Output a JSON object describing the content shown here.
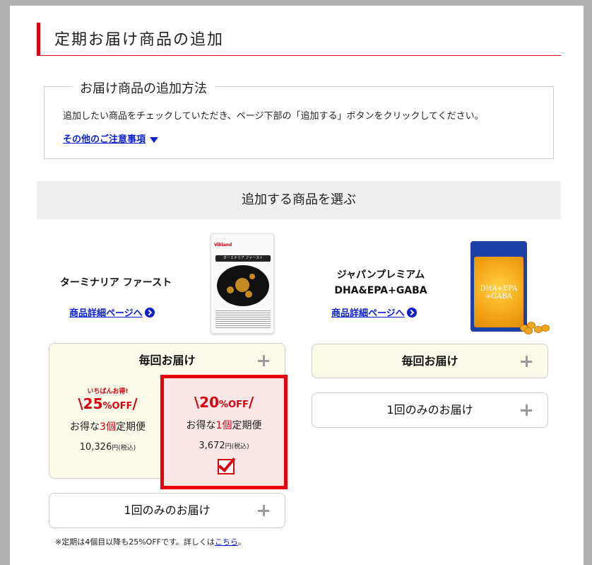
{
  "page_title": "定期お届け商品の追加",
  "method": {
    "heading": "お届け商品の追加方法",
    "text": "追加したい商品をチェックしていただき、ページ下部の「追加する」ボタンをクリックしてください。",
    "notes_link": "その他のご注意事項"
  },
  "select_heading": "追加する商品を選ぶ",
  "products": [
    {
      "name": "ターミナリア ファースト",
      "detail_link": "商品詳細ページへ",
      "image_brand": "Vikland",
      "image_label": "ターミナリア ファースト",
      "every_time": {
        "label": "毎回お届け",
        "options": [
          {
            "badge": "いちばんお得!",
            "off_pre": "\\",
            "off_num": "25",
            "off_unit": "%OFF",
            "off_post": "/",
            "desc_pre": "お得な",
            "desc_num": "3個",
            "desc_post": "定期便",
            "price": "10,326",
            "price_unit": "円(税込)",
            "selected": false
          },
          {
            "badge": "",
            "off_pre": "\\",
            "off_num": "20",
            "off_unit": "%OFF",
            "off_post": "/",
            "desc_pre": "お得な",
            "desc_num": "1個",
            "desc_post": "定期便",
            "price": "3,672",
            "price_unit": "円(税込)",
            "selected": true
          }
        ]
      },
      "once": {
        "label": "1回のみのお届け"
      }
    },
    {
      "name_line1": "ジャパンプレミアム",
      "name_line2": "DHA&EPA+GABA",
      "detail_link": "商品詳細ページへ",
      "image_text": "DHA+EPA +GABA",
      "every_time": {
        "label": "毎回お届け"
      },
      "once": {
        "label": "1回のみのお届け"
      }
    }
  ],
  "footnote": {
    "text": "※定期は4個目以降も25%OFFです。詳しくは",
    "link": "こちら",
    "end": "。"
  },
  "colors": {
    "accent_red": "#d7000f",
    "link_blue": "#0b1fd1",
    "cream": "#fcfbe9",
    "selected_bg": "#fce7e7",
    "section_bg": "#efefef"
  },
  "icons": [
    "chevron-down-icon",
    "arrow-circle-right-icon",
    "plus-icon",
    "checkbox-checked-icon"
  ]
}
